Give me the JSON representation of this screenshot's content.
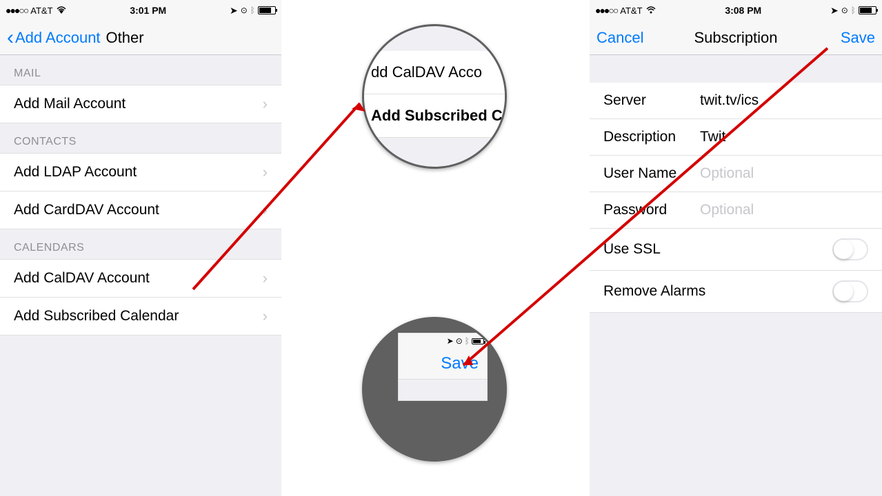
{
  "left_phone": {
    "status": {
      "dots": "●●●○○",
      "carrier": "AT&T",
      "wifi": "Wi-Fi",
      "time": "3:01 PM",
      "icons": "location, alarm, bluetooth, battery"
    },
    "nav": {
      "back": "Add Account",
      "title": "Other"
    },
    "sections": {
      "mail_header": "MAIL",
      "mail_item": "Add Mail Account",
      "contacts_header": "CONTACTS",
      "contacts_item1": "Add LDAP Account",
      "contacts_item2": "Add CardDAV Account",
      "calendars_header": "CALENDARS",
      "calendars_item1": "Add CalDAV Account",
      "calendars_item2": "Add Subscribed Calendar"
    }
  },
  "right_phone": {
    "status": {
      "dots": "●●●○○",
      "carrier": "AT&T",
      "wifi": "Wi-Fi",
      "time": "3:08 PM",
      "icons": "location, alarm, bluetooth, battery"
    },
    "nav": {
      "cancel": "Cancel",
      "title": "Subscription",
      "save": "Save"
    },
    "form": {
      "server_label": "Server",
      "server_value": "twit.tv/ics",
      "desc_label": "Description",
      "desc_value": "Twit",
      "user_label": "User Name",
      "user_placeholder": "Optional",
      "pass_label": "Password",
      "pass_placeholder": "Optional",
      "ssl_label": "Use SSL",
      "alarms_label": "Remove Alarms"
    }
  },
  "zoom_top": {
    "row1": "dd CalDAV Acco",
    "row2": "Add Subscribed Ca"
  },
  "zoom_bottom": {
    "save": "Save"
  }
}
